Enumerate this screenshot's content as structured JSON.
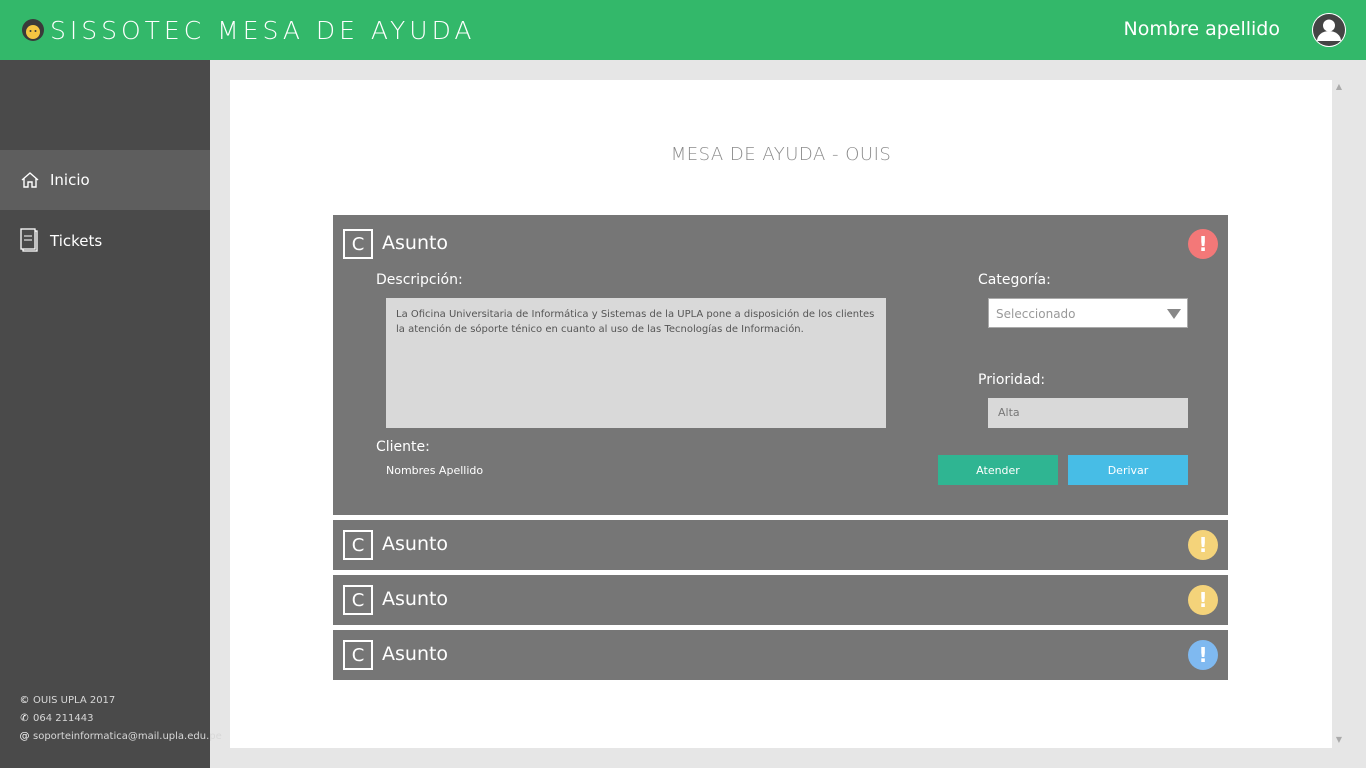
{
  "header": {
    "title": "SISSOTEC MESA DE AYUDA",
    "user_name": "Nombre apellido",
    "color": "#33b86a"
  },
  "sidebar": {
    "items": [
      {
        "label": "Inicio",
        "icon": "home-icon",
        "active": true
      },
      {
        "label": "Tickets",
        "icon": "tickets-icon",
        "active": false
      }
    ],
    "footer": {
      "copyright": "OUIS UPLA 2017",
      "phone": "064 211443",
      "email": "soporteinformatica@mail.upla.edu.pe"
    }
  },
  "main": {
    "title": "MESA DE AYUDA - OUIS",
    "tickets": [
      {
        "badge": "C",
        "subject": "Asunto",
        "priority_color": "#f37878",
        "expanded": true,
        "description_label": "Descripción:",
        "description": "La Oficina Universitaria de Informática y Sistemas de la UPLA pone a disposición de los clientes la atención de sóporte ténico en cuanto al uso de las Tecnologías de Información.",
        "client_label": "Cliente:",
        "client": "Nombres Apellido",
        "category_label": "Categoría:",
        "category_value": "Seleccionado",
        "priority_label": "Prioridad:",
        "priority_value": "Alta",
        "attend_label": "Atender",
        "derive_label": "Derivar"
      },
      {
        "badge": "C",
        "subject": "Asunto",
        "priority_color": "#f4d37a"
      },
      {
        "badge": "C",
        "subject": "Asunto",
        "priority_color": "#f4d37a"
      },
      {
        "badge": "C",
        "subject": "Asunto",
        "priority_color": "#7fb9f0"
      }
    ]
  }
}
